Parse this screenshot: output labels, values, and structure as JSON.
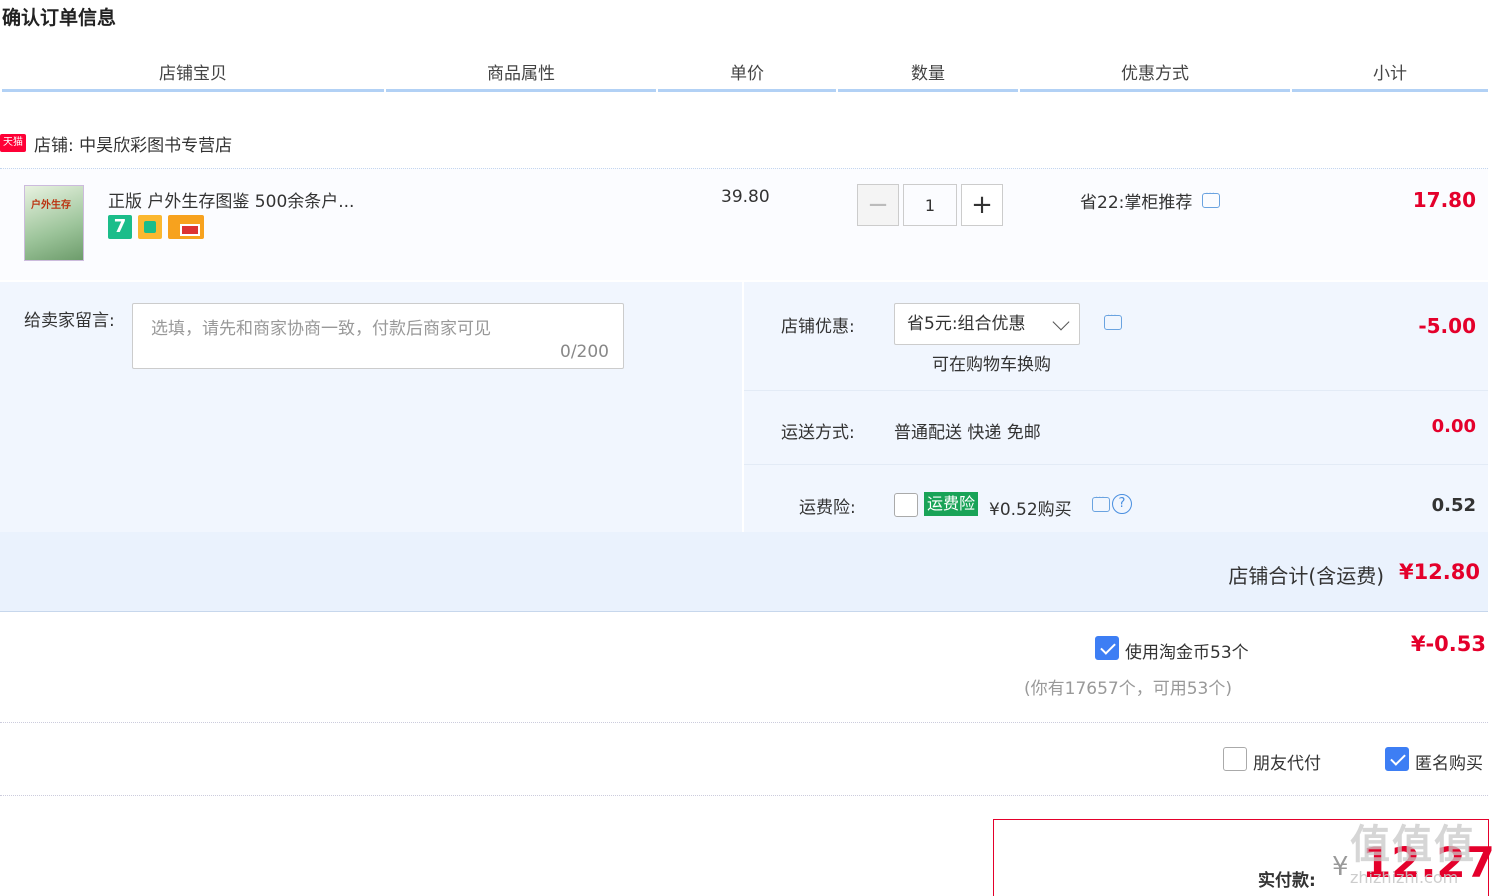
{
  "page": {
    "title": "确认订单信息"
  },
  "columns": [
    "店铺宝贝",
    "商品属性",
    "单价",
    "数量",
    "优惠方式",
    "小计"
  ],
  "shop": {
    "badge": "天猫",
    "name": "店铺: 中昊欣彩图书专营店"
  },
  "item": {
    "title": "正版 户外生存图鉴 500余条户...",
    "thumb_text": "户外生存",
    "icons": [
      "seven-day-return-icon",
      "shopping-bag-icon",
      "credit-card-icon"
    ],
    "icon_7": "7",
    "unit_price": "39.80",
    "quantity": "1",
    "discount": "省22:掌柜推荐",
    "subtotal": "17.80"
  },
  "memo": {
    "label": "给卖家留言:",
    "placeholder": "选填，请先和商家协商一致，付款后商家可见",
    "counter": "0/200"
  },
  "shop_discount": {
    "label": "店铺优惠:",
    "selected": "省5元:组合优惠",
    "hint": "可在购物车换购",
    "value": "-5.00"
  },
  "shipping": {
    "label": "运送方式:",
    "method": "普通配送 快递 免邮",
    "value": "0.00"
  },
  "insurance": {
    "label": "运费险:",
    "tag": "运费险",
    "desc": "¥0.52购买",
    "help": "?",
    "value": "0.52",
    "checked": false
  },
  "shop_total": {
    "label": "店铺合计(含运费)",
    "value": "¥12.80"
  },
  "coins": {
    "label": "使用淘金币53个",
    "note": "(你有17657个，可用53个)",
    "value": "¥-0.53",
    "checked": true
  },
  "options": {
    "friend_pay": "朋友代付",
    "friend_pay_checked": false,
    "anonymous": "匿名购买",
    "anonymous_checked": true
  },
  "payment": {
    "label": "实付款:",
    "currency": "¥",
    "amount": "12.27"
  },
  "watermark": {
    "main": "值值值",
    "sub": "zhizhizhi.com"
  },
  "colors": {
    "accent_red": "#e4002b",
    "header_line": "#b2d1f5",
    "panel_bg": "#f1f6fe",
    "checkbox_blue": "#3d7ef4",
    "insurance_green": "#19a357"
  }
}
